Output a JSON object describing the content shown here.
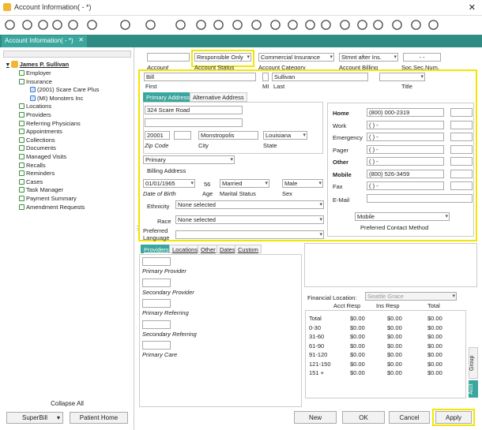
{
  "window": {
    "title": "Account Information( -   *)"
  },
  "tab": {
    "label": "Account Information( -  *)"
  },
  "tree": {
    "root": "James P. Sullivan",
    "items": [
      {
        "label": "Employer",
        "indent": 1
      },
      {
        "label": "Insurance",
        "indent": 1
      },
      {
        "label": "(2001) Scare Care Plus",
        "indent": 2
      },
      {
        "label": "(MI) Monsters Inc",
        "indent": 2
      },
      {
        "label": "Locations",
        "indent": 1
      },
      {
        "label": "Providers",
        "indent": 1
      },
      {
        "label": "Referring Physicians",
        "indent": 1
      },
      {
        "label": "Appointments",
        "indent": 1
      },
      {
        "label": "Collections",
        "indent": 1
      },
      {
        "label": "Documents",
        "indent": 1
      },
      {
        "label": "Managed Visits",
        "indent": 1
      },
      {
        "label": "Recalls",
        "indent": 1
      },
      {
        "label": "Reminders",
        "indent": 1
      },
      {
        "label": "Cases",
        "indent": 1
      },
      {
        "label": "Task Manager",
        "indent": 1
      },
      {
        "label": "Payment Summary",
        "indent": 1
      },
      {
        "label": "Amendment Requests",
        "indent": 1
      }
    ],
    "collapse_all": "Collapse All"
  },
  "footer_left": {
    "superbill": "SuperBill",
    "patient_home": "Patient Home"
  },
  "account": {
    "account_label": "Account",
    "status_value": "Responsible Only",
    "status_label": "Account Status",
    "category_value": "Commercial Insurance",
    "category_label": "Account Category",
    "billing_value": "Stmnt after Ins.",
    "billing_label": "Account Billing",
    "ssn_value": "-   -",
    "ssn_label": "Soc.Sec.Num."
  },
  "name": {
    "first_value": "Bill",
    "first_label": "First",
    "mi_label": "MI",
    "last_value": "Sullivan",
    "last_label": "Last",
    "title_label": "Title"
  },
  "address": {
    "tab_primary": "Primary Address",
    "tab_alternative": "Alternative Address",
    "line1": "324 Scare Road",
    "zip": "20001",
    "zip_label": "Zip Code",
    "city": "Monstropolis",
    "city_label": "City",
    "state": "Louisiana",
    "state_label": "State",
    "billing": "Primary",
    "billing_label": "Billing Address"
  },
  "demo": {
    "dob": "01/01/1965",
    "dob_label": "Date of Birth",
    "age": "56",
    "age_label": "Age",
    "marital": "Married",
    "marital_label": "Marital Status",
    "sex": "Male",
    "sex_label": "Sex",
    "ethnicity_label": "Ethnicity",
    "ethnicity_value": "None selected",
    "race_label": "Race",
    "race_value": "None selected",
    "language_label": "Preferred Language"
  },
  "phones": {
    "home_label": "Home",
    "home": "(800) 000-2319",
    "work_label": "Work",
    "work": "(   )    -",
    "emergency_label": "Emergency",
    "emergency": "(   )    -",
    "pager_label": "Pager",
    "pager": "(   )    -",
    "other_label": "Other",
    "other": "(   )    -",
    "mobile_label": "Mobile",
    "mobile": "(800) 526-3459",
    "fax_label": "Fax",
    "fax": "(   )    -",
    "email_label": "E-Mail",
    "contact_value": "Mobile",
    "contact_label": "Preferred Contact Method"
  },
  "subtabs": [
    "Providers",
    "Locations",
    "Other",
    "Dates",
    "Custom"
  ],
  "providers": {
    "primary": "Primary Provider",
    "secondary": "Secondary Provider",
    "primary_ref": "Primary Referring",
    "secondary_ref": "Secondary  Referring",
    "primary_care": "Primary Care"
  },
  "financial": {
    "location_label": "Financial Location:",
    "location_value": "Seattle Grace",
    "col_acct": "Acct Resp",
    "col_ins": "Ins Resp",
    "col_total": "Total",
    "rows": [
      {
        "label": "Total",
        "a": "$0.00",
        "b": "$0.00",
        "c": "$0.00"
      },
      {
        "label": "0-30",
        "a": "$0.00",
        "b": "$0.00",
        "c": "$0.00"
      },
      {
        "label": "31-60",
        "a": "$0.00",
        "b": "$0.00",
        "c": "$0.00"
      },
      {
        "label": "61-90",
        "a": "$0.00",
        "b": "$0.00",
        "c": "$0.00"
      },
      {
        "label": "91-120",
        "a": "$0.00",
        "b": "$0.00",
        "c": "$0.00"
      },
      {
        "label": "121-150",
        "a": "$0.00",
        "b": "$0.00",
        "c": "$0.00"
      },
      {
        "label": "151 +",
        "a": "$0.00",
        "b": "$0.00",
        "c": "$0.00"
      }
    ],
    "side_tab_group": "Group",
    "side_tab_acct": "Acct"
  },
  "footer_right": {
    "new": "New",
    "ok": "OK",
    "cancel": "Cancel",
    "apply": "Apply"
  },
  "colors": {
    "teal": "#2e8c84",
    "highlight": "#f2e600"
  }
}
